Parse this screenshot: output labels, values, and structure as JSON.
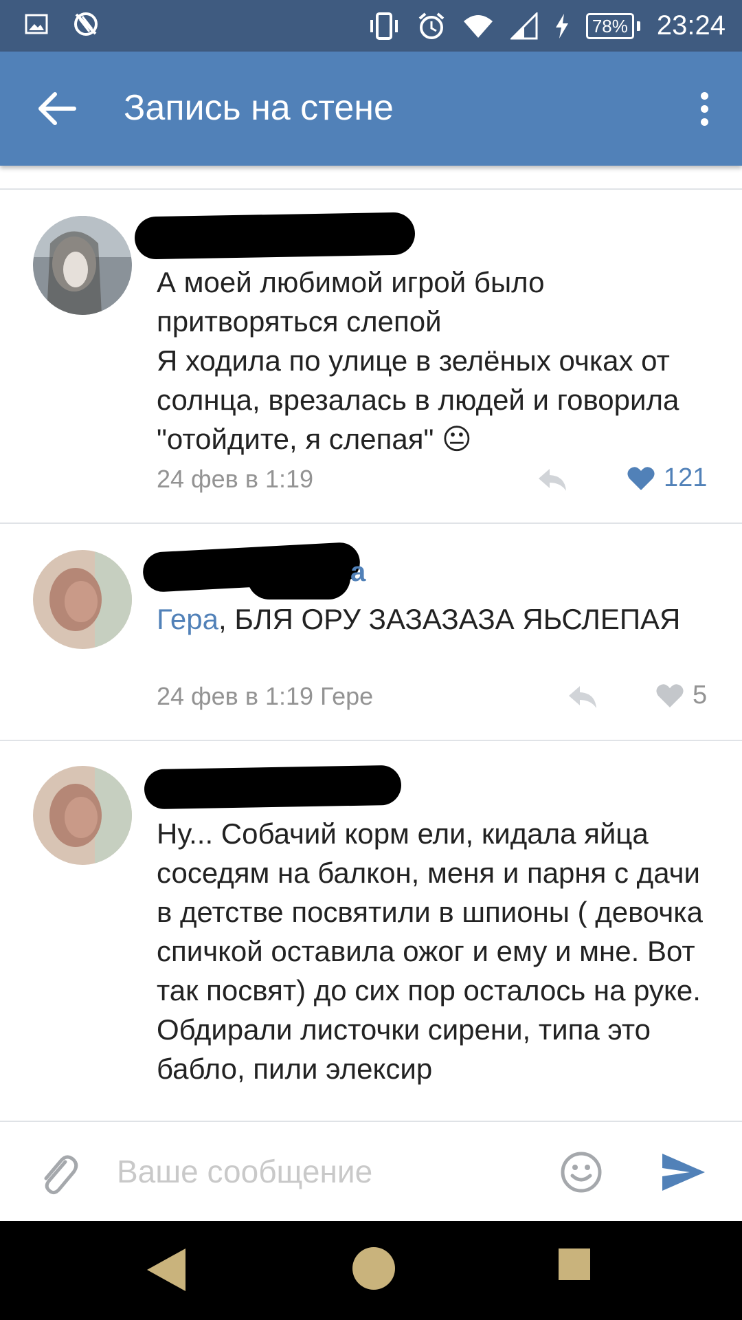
{
  "status_bar": {
    "time": "23:24",
    "battery": "78%",
    "icons": [
      "image-icon",
      "no-sync-icon",
      "vibrate-icon",
      "alarm-icon",
      "wifi-icon",
      "signal-icon",
      "charging-icon"
    ]
  },
  "header": {
    "title": "Запись на стене"
  },
  "comments": [
    {
      "author_visible": "",
      "text": "А моей любимой игрой было притворяться слепой\nЯ ходила по улице в зелёных очках от солнца, врезалась в людей и говорила \"отойдите, я слепая\" 😐",
      "date": "24 фев в 1:19",
      "likes": "121",
      "liked": true
    },
    {
      "author_visible": "а",
      "mention": "Гера",
      "text": ", БЛЯ ОРУ ЗАЗАЗАЗА ЯЬСЛЕПАЯ",
      "date": "24 фев в 1:19 Гере",
      "likes": "5",
      "liked": false
    },
    {
      "author_visible": "",
      "text": "Ну... Собачий корм ели, кидала яйца соседям на балкон, меня и парня с дачи в детстве посвятили в шпионы ( девочка спичкой оставила ожог и ему и мне. Вот так посвят) до сих пор осталось на руке. Обдирали листочки сирени, типа это бабло, пили элексир"
    }
  ],
  "composer": {
    "placeholder": "Ваше сообщение"
  },
  "colors": {
    "status_bar": "#3f5b80",
    "app_bar": "#5181b8",
    "accent": "#5181b8",
    "nav_bar": "#000000"
  }
}
